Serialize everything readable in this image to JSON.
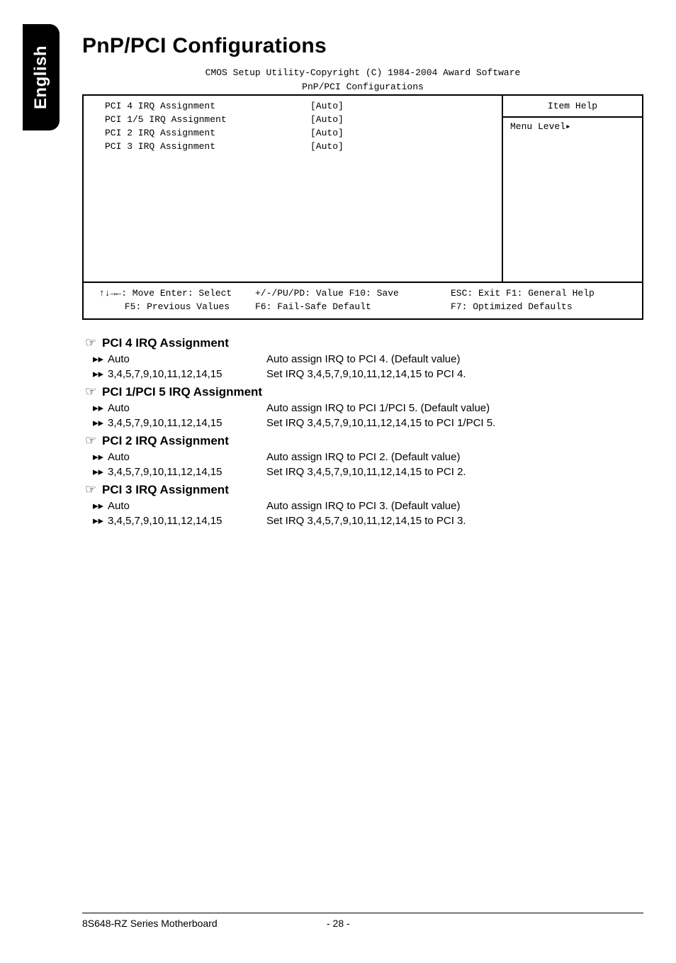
{
  "sideTab": "English",
  "title": "PnP/PCI Configurations",
  "biosCaption1": "CMOS Setup Utility-Copyright (C) 1984-2004 Award Software",
  "biosCaption2": "PnP/PCI Configurations",
  "biosRows": [
    {
      "label": "PCI 4 IRQ Assignment",
      "value": "[Auto]"
    },
    {
      "label": "PCI 1/5 IRQ Assignment",
      "value": "[Auto]"
    },
    {
      "label": "PCI 2 IRQ Assignment",
      "value": "[Auto]"
    },
    {
      "label": "PCI 3 IRQ Assignment",
      "value": "[Auto]"
    }
  ],
  "biosHelpTitle": "Item Help",
  "biosHelpLevel": "Menu Level▸",
  "biosBottom": {
    "r1c1": "↑↓→←: Move   Enter: Select",
    "r1c2": "+/-/PU/PD: Value   F10: Save",
    "r1c3": "ESC: Exit   F1: General Help",
    "r2c1": "F5: Previous Values",
    "r2c2": "F6: Fail-Safe Default",
    "r2c3": "F7: Optimized Defaults"
  },
  "options": [
    {
      "title": "PCI 4 IRQ Assignment",
      "rows": [
        {
          "label": "Auto",
          "desc": "Auto assign IRQ to PCI 4. (Default value)"
        },
        {
          "label": "3,4,5,7,9,10,11,12,14,15",
          "desc": "Set IRQ 3,4,5,7,9,10,11,12,14,15 to PCI 4."
        }
      ]
    },
    {
      "title": "PCI 1/PCI 5 IRQ Assignment",
      "rows": [
        {
          "label": "Auto",
          "desc": "Auto assign IRQ to PCI 1/PCI 5. (Default value)"
        },
        {
          "label": "3,4,5,7,9,10,11,12,14,15",
          "desc": "Set IRQ 3,4,5,7,9,10,11,12,14,15 to PCI 1/PCI 5."
        }
      ]
    },
    {
      "title": "PCI 2 IRQ Assignment",
      "rows": [
        {
          "label": "Auto",
          "desc": "Auto assign IRQ to PCI 2. (Default value)"
        },
        {
          "label": "3,4,5,7,9,10,11,12,14,15",
          "desc": "Set IRQ 3,4,5,7,9,10,11,12,14,15 to PCI 2."
        }
      ]
    },
    {
      "title": "PCI 3 IRQ Assignment",
      "rows": [
        {
          "label": "Auto",
          "desc": "Auto assign IRQ to PCI 3. (Default value)"
        },
        {
          "label": "3,4,5,7,9,10,11,12,14,15",
          "desc": "Set IRQ 3,4,5,7,9,10,11,12,14,15 to PCI 3."
        }
      ]
    }
  ],
  "footerLeft": "8S648-RZ Series Motherboard",
  "footerRight": "- 28 -",
  "glyphs": {
    "hand": "☞",
    "harrow": "▸▸"
  }
}
